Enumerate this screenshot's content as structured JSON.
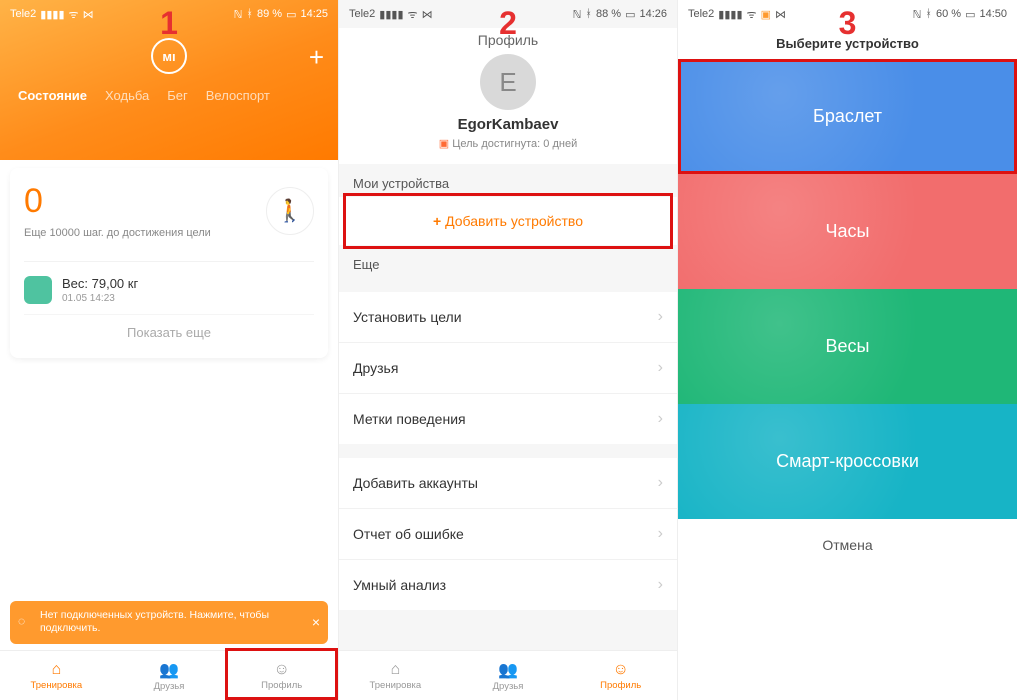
{
  "numbers": {
    "1": "1",
    "2": "2",
    "3": "3"
  },
  "status": {
    "carrier": "Tele2",
    "signal": "📶",
    "wifi": "≋",
    "cast": "⇆",
    "nfc": "ℕ",
    "bt": "ᛒ",
    "p1_batt": "89 %",
    "p1_time": "14:25",
    "p2_batt": "88 %",
    "p2_time": "14:26",
    "p3_batt": "60 %",
    "p3_time": "14:50"
  },
  "p1": {
    "tabs": {
      "state": "Состояние",
      "walk": "Ходьба",
      "run": "Бег",
      "bike": "Велоспорт"
    },
    "steps": "0",
    "steps_sub": "Еще 10000 шаг. до достижения цели",
    "weight_label": "Вес: 79,00  кг",
    "weight_date": "01.05 14:23",
    "show_more": "Показать еще",
    "toast": "Нет подключенных устройств. Нажмите, чтобы подключить.",
    "nav": {
      "train": "Тренировка",
      "friends": "Друзья",
      "profile": "Профиль"
    }
  },
  "p2": {
    "title": "Профиль",
    "avatar_letter": "Е",
    "username": "EgorKambaev",
    "goal": "Цель достигнута: 0 дней",
    "section_devices": "Мои устройства",
    "add_device": "Добавить устройство",
    "section_more": "Еще",
    "items": [
      "Установить цели",
      "Друзья",
      "Метки поведения"
    ],
    "items2": [
      "Добавить аккаунты",
      "Отчет об ошибке",
      "Умный анализ"
    ],
    "nav": {
      "train": "Тренировка",
      "friends": "Друзья",
      "profile": "Профиль"
    }
  },
  "p3": {
    "title": "Выберите устройство",
    "bracelet": "Браслет",
    "watch": "Часы",
    "scale": "Весы",
    "shoes": "Смарт-кроссовки",
    "cancel": "Отмена"
  }
}
